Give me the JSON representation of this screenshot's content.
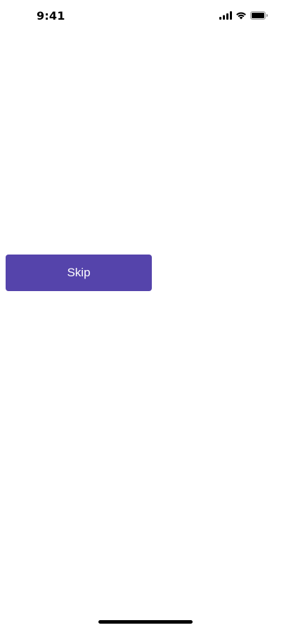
{
  "status_bar": {
    "time": "9:41",
    "icons": [
      "cellular-signal-icon",
      "wifi-icon",
      "battery-icon"
    ]
  },
  "main": {
    "skip_label": "Skip"
  },
  "colors": {
    "button_background": "#5544ab",
    "button_text": "#ffffff",
    "page_background": "#ffffff"
  }
}
